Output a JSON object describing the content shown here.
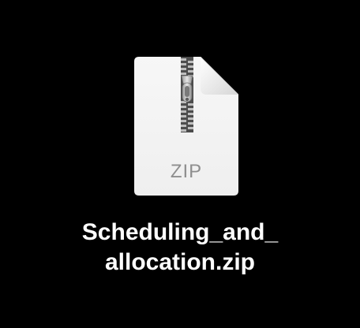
{
  "file": {
    "icon": "zip-archive-icon",
    "type_label": "ZIP",
    "name_line1": "Scheduling_and_",
    "name_line2": "allocation.zip"
  },
  "colors": {
    "background": "#000000",
    "document": "#f4f4f4",
    "zipper": "#5a5a5a",
    "label": "#8e8e8e",
    "filename": "#ffffff"
  }
}
